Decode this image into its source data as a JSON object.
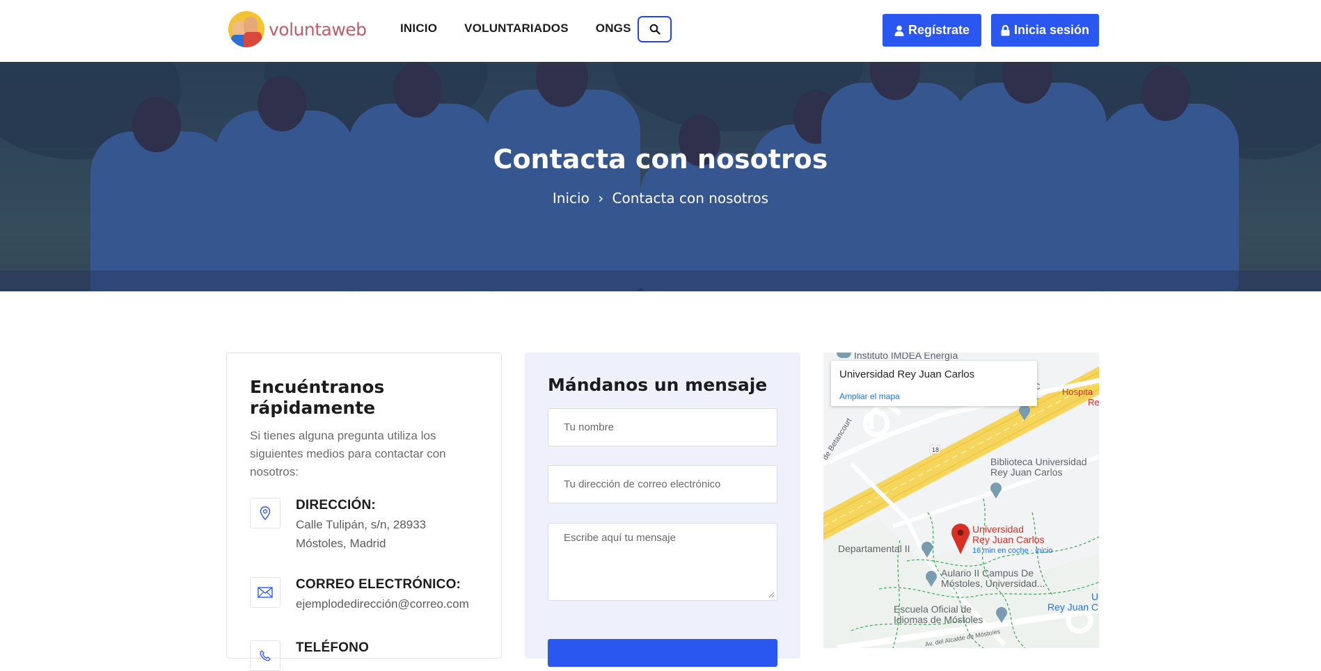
{
  "header": {
    "logo_text": "voluntaweb",
    "nav": [
      "INICIO",
      "VOLUNTARIADOS",
      "ONGS"
    ],
    "register_label": "Regístrate",
    "login_label": "Inicia sesión"
  },
  "hero": {
    "title": "Contacta con nosotros",
    "breadcrumb": {
      "home": "Inicio",
      "separator": "›",
      "current": "Contacta con nosotros"
    }
  },
  "info_card": {
    "title": "Encuéntranos rápidamente",
    "intro": "Si tienes alguna pregunta utiliza los siguientes medios para contactar con nosotros:",
    "items": [
      {
        "icon": "location-pin-icon",
        "label": "DIRECCIÓN:",
        "value": "Calle Tulipán, s/n, 28933 Móstoles, Madrid"
      },
      {
        "icon": "envelope-icon",
        "label": "CORREO ELECTRÓNICO:",
        "value": "ejemplodedirección@correo.com"
      },
      {
        "icon": "phone-icon",
        "label": "TELÉFONO",
        "value": ""
      }
    ]
  },
  "form_card": {
    "title": "Mándanos un mensaje",
    "name_placeholder": "Tu nombre",
    "email_placeholder": "Tu dirección de correo electrónico",
    "message_placeholder": "Escribe aquí tu mensaje"
  },
  "map": {
    "popup_title": "Universidad Rey Juan Carlos",
    "popup_link": "Ampliar el mapa",
    "labels": {
      "imdea": "Instituto IMDEA Energía",
      "hospital": "Hospita",
      "hospital2": "Re",
      "betancourt": "de Betancourt",
      "road_num": "18",
      "biblioteca1": "Biblioteca Universidad",
      "biblioteca2": "Rey Juan Carlos",
      "urjc1": "Universidad",
      "urjc2": "Rey Juan Carlos",
      "drive": "16 min en coche · inicio",
      "departamental": "Departamental II",
      "aulario1": "Aulario II Campus De",
      "aulario2": "Móstoles, Universidad...",
      "escuela1": "Escuela Oficial de",
      "escuela2": "Idiomas de Móstoles",
      "univ_right1": "Univers",
      "univ_right2": "Rey Juan C",
      "avenida": "Av. del Alcalde de Móstoles",
      "c_letter": "C",
      "l_letter": "L"
    },
    "colors": {
      "highway": "#f9e18a",
      "paths": "#34a853",
      "pin": "#d93025"
    }
  },
  "colors": {
    "accent": "#2a57f0",
    "form_bg": "#eef0fc",
    "overlay": "#26346e"
  }
}
